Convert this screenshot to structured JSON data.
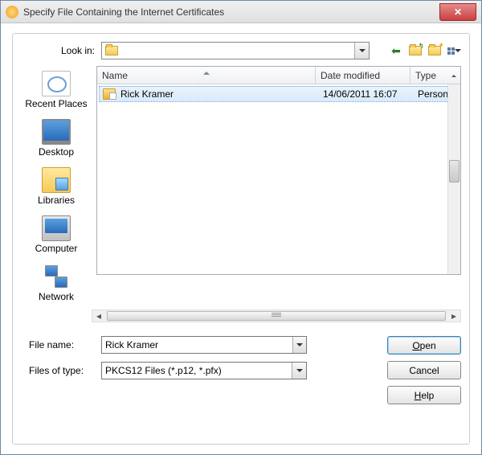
{
  "title": "Specify File Containing the Internet Certificates",
  "lookin": {
    "label": "Look in:",
    "value": ""
  },
  "places": [
    {
      "key": "recent",
      "label": "Recent Places"
    },
    {
      "key": "desktop",
      "label": "Desktop"
    },
    {
      "key": "libraries",
      "label": "Libraries"
    },
    {
      "key": "computer",
      "label": "Computer"
    },
    {
      "key": "network",
      "label": "Network"
    }
  ],
  "columns": {
    "name": "Name",
    "date": "Date modified",
    "type": "Type"
  },
  "files": [
    {
      "name": "Rick Kramer",
      "date": "14/06/2011 16:07",
      "type": "Person"
    }
  ],
  "filename": {
    "label": "File name:",
    "value": "Rick Kramer"
  },
  "filetype": {
    "label": "Files of type:",
    "value": "PKCS12 Files (*.p12, *.pfx)"
  },
  "buttons": {
    "open": "Open",
    "cancel": "Cancel",
    "help": "Help"
  }
}
